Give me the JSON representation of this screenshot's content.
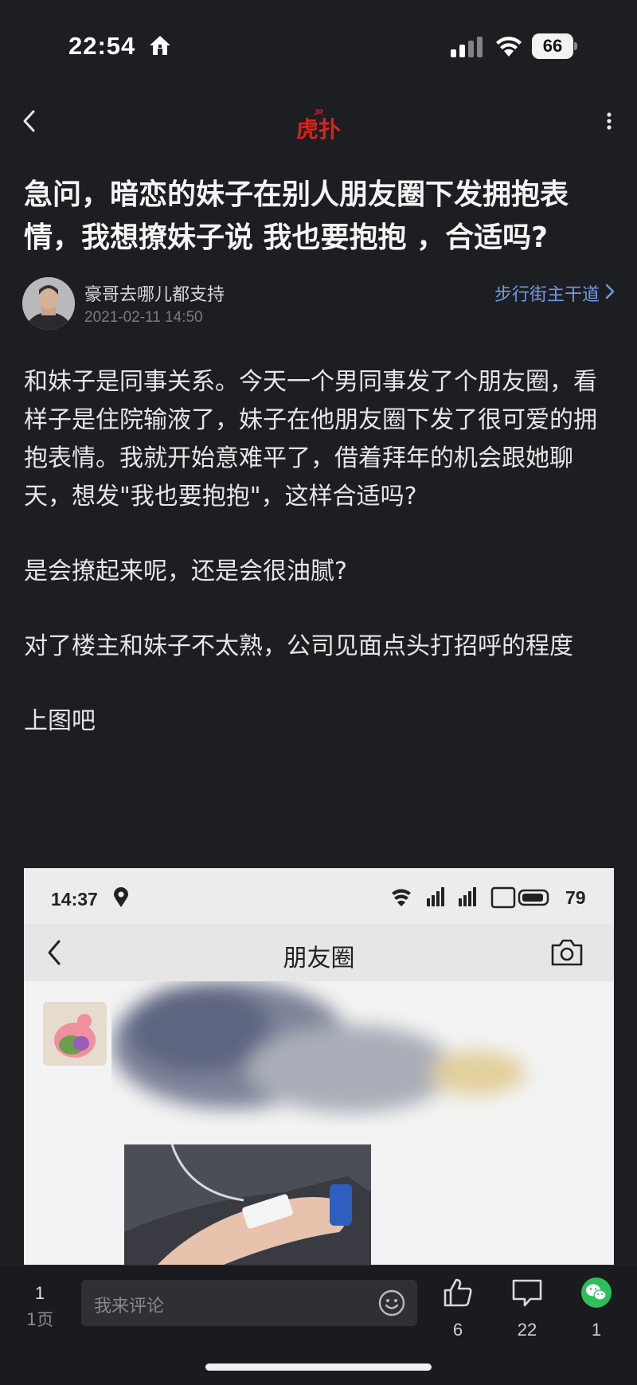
{
  "status_bar": {
    "time": "22:54",
    "battery": "66"
  },
  "nav": {
    "logo_text": "虎扑",
    "logo_badge": "JR"
  },
  "post": {
    "title": "急问，暗恋的妹子在别人朋友圈下发拥抱表情，我想撩妹子说 我也要抱抱 ，合适吗?",
    "author": "豪哥去哪儿都支持",
    "time": "2021-02-11 14:50",
    "board": "步行街主干道",
    "paragraphs": [
      "和妹子是同事关系。今天一个男同事发了个朋友圈，看样子是住院输液了，妹子在他朋友圈下发了很可爱的拥抱表情。我就开始意难平了，借着拜年的机会跟她聊天，想发\"我也要抱抱\"，这样合适吗?",
      "是会撩起来呢，还是会很油腻?",
      "对了楼主和妹子不太熟，公司见面点头打招呼的程度",
      "上图吧"
    ]
  },
  "embedded_screenshot": {
    "time": "14:37",
    "battery": "79",
    "title": "朋友圈"
  },
  "bottom_bar": {
    "page_number": "1",
    "page_label": "1页",
    "comment_placeholder": "我来评论",
    "likes": "6",
    "comments": "22",
    "shares": "1"
  },
  "colors": {
    "background": "#1d1e22",
    "link": "#6f99e6",
    "logo_red": "#e0201d",
    "wechat_green": "#2fbf5a"
  }
}
